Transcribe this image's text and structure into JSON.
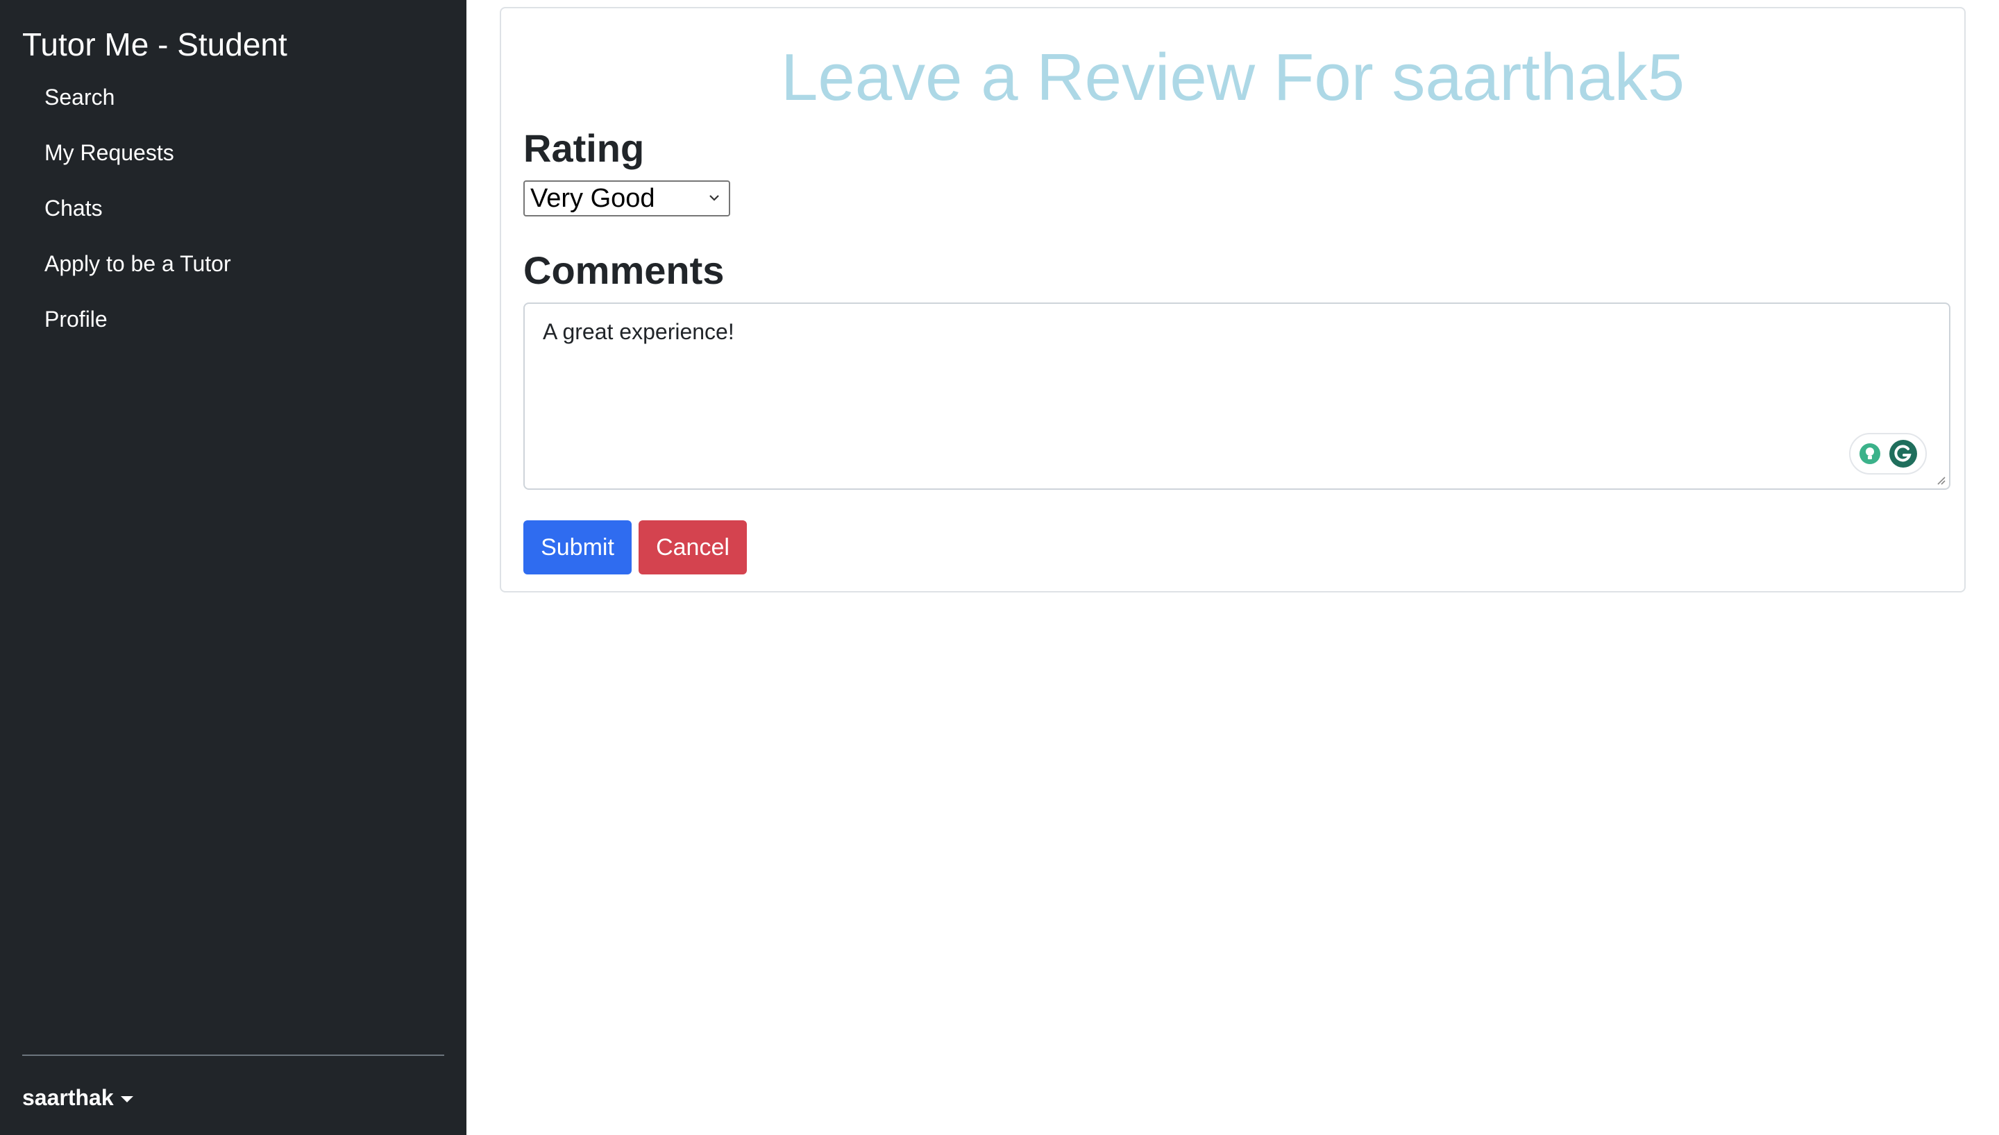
{
  "sidebar": {
    "brand": "Tutor Me - Student",
    "items": [
      {
        "label": "Search"
      },
      {
        "label": "My Requests"
      },
      {
        "label": "Chats"
      },
      {
        "label": "Apply to be a Tutor"
      },
      {
        "label": "Profile"
      }
    ],
    "user": {
      "name": "saarthak",
      "caret_icon": "caret-down-icon"
    }
  },
  "review": {
    "title": "Leave a Review For saarthak5",
    "rating_label": "Rating",
    "rating_value": "Very Good",
    "comments_label": "Comments",
    "comments_value": "A great experience!",
    "submit_label": "Submit",
    "cancel_label": "Cancel"
  },
  "colors": {
    "sidebar_bg": "#212529",
    "title": "#add8e6",
    "submit": "#2f6cf0",
    "cancel": "#d4434f"
  },
  "icons": {
    "select_chevron": "chevron-down-icon",
    "grammarly_bulb": "lightbulb-icon",
    "grammarly_logo": "grammarly-icon",
    "resize": "resize-handle-icon"
  }
}
